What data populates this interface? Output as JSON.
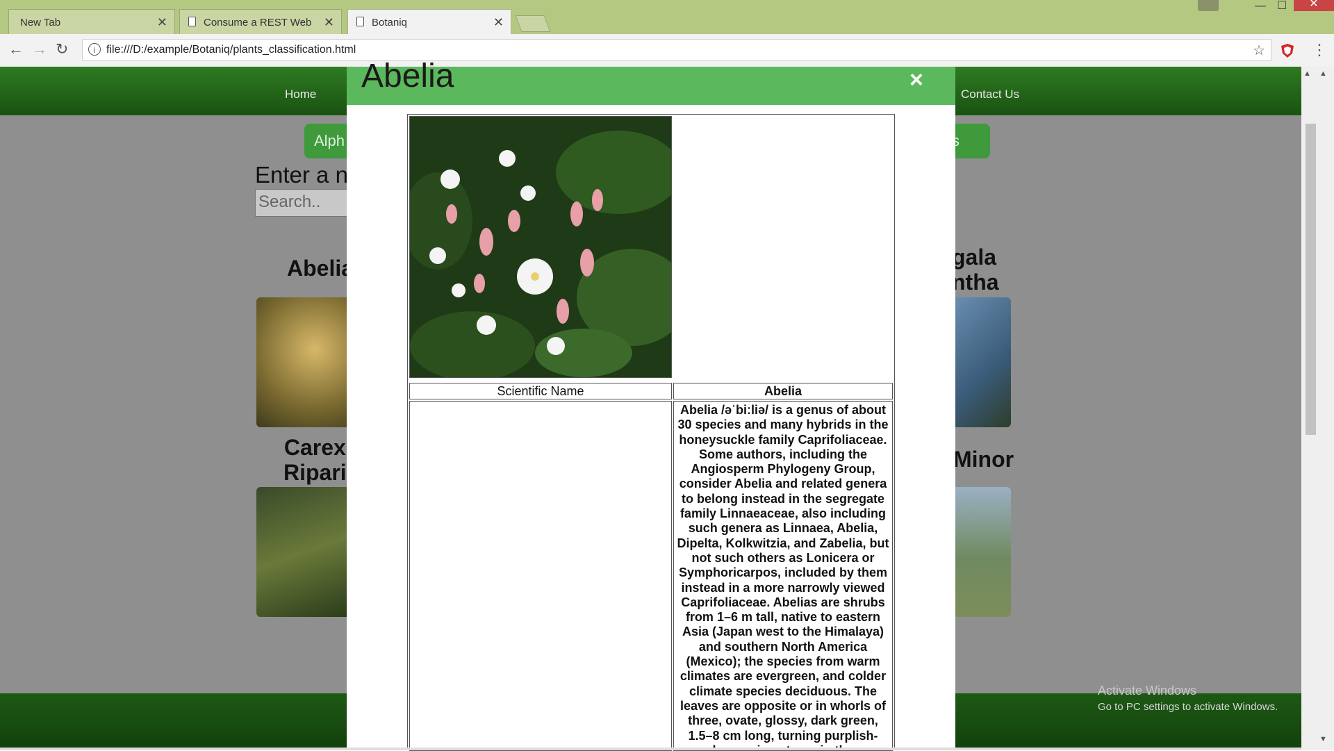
{
  "browser": {
    "tabs": [
      {
        "title": "New Tab"
      },
      {
        "title": "Consume a REST Web Se"
      },
      {
        "title": "Botaniq"
      }
    ],
    "url": "file:///D:/example/Botaniq/plants_classification.html"
  },
  "page": {
    "nav": {
      "home": "Home",
      "contact": "Contact Us"
    },
    "filter_button_left": "Alph",
    "filter_button_right": "s",
    "search_label": "Enter a n",
    "search_placeholder": "Search..",
    "plants": [
      {
        "name": "Abelia"
      },
      {
        "name": "gala\nntha"
      },
      {
        "name": "Carex\nRipari"
      },
      {
        "name": "Minor"
      }
    ],
    "watermark_title": "Activate Windows",
    "watermark_sub": "Go to PC settings to activate Windows."
  },
  "modal": {
    "title": "Abelia",
    "close_symbol": "×",
    "sci_label": "Scientific Name",
    "sci_value": "Abelia",
    "description": "Abelia /əˈbiːliə/ is a genus of about 30 species and many hybrids in the honeysuckle family Caprifoliaceae. Some authors, including the Angiosperm Phylogeny Group, consider Abelia and related genera to belong instead in the segregate family Linnaeaceae, also including such genera as Linnaea, Abelia, Dipelta, Kolkwitzia, and Zabelia, but not such others as Lonicera or Symphoricarpos, included by them instead in a more narrowly viewed Caprifoliaceae. Abelias are shrubs from 1–6 m tall, native to eastern Asia (Japan west to the Himalaya) and southern North America (Mexico); the species from warm climates are evergreen, and colder climate species deciduous. The leaves are opposite or in whorls of three, ovate, glossy, dark green, 1.5–8 cm long, turning purplish-bronze in autumn in the"
  }
}
